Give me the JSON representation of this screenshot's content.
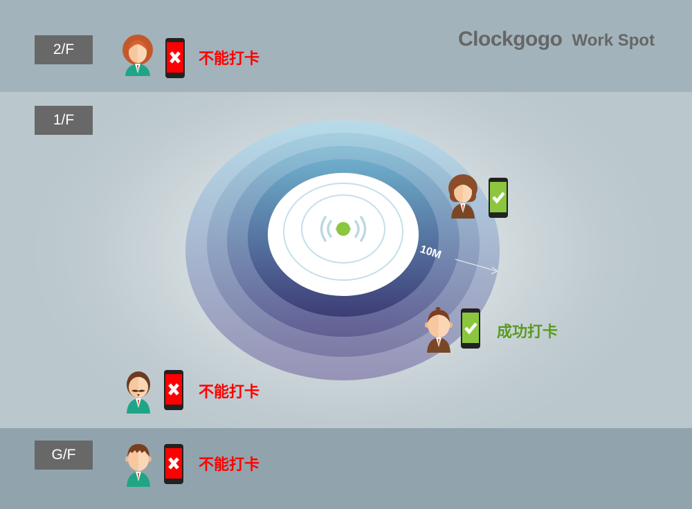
{
  "logo": {
    "brand": "Clockgogo",
    "product": "Work Spot"
  },
  "floors": [
    {
      "label": "2/F"
    },
    {
      "label": "1/F"
    },
    {
      "label": "G/F"
    }
  ],
  "range": {
    "distance_label": "10M"
  },
  "employees": [
    {
      "floor": "2/F",
      "avatar": "female-green-suit",
      "phone_status": "fail",
      "status_text": "不能打卡"
    },
    {
      "floor": "1/F",
      "avatar": "female-brown-suit",
      "phone_status": "ok",
      "status_text": ""
    },
    {
      "floor": "1/F",
      "avatar": "male-brown-suit",
      "phone_status": "ok",
      "status_text": "成功打卡"
    },
    {
      "floor": "1/F",
      "avatar": "male-mustache-green-suit",
      "phone_status": "fail",
      "status_text": "不能打卡"
    },
    {
      "floor": "G/F",
      "avatar": "male-green-suit",
      "phone_status": "fail",
      "status_text": "不能打卡"
    }
  ],
  "colors": {
    "fail": "#ff0000",
    "ok": "#8cc63f",
    "ok_text": "#5a9a1e",
    "beacon": "#8cc63f",
    "floor_label_bg": "#686868"
  }
}
